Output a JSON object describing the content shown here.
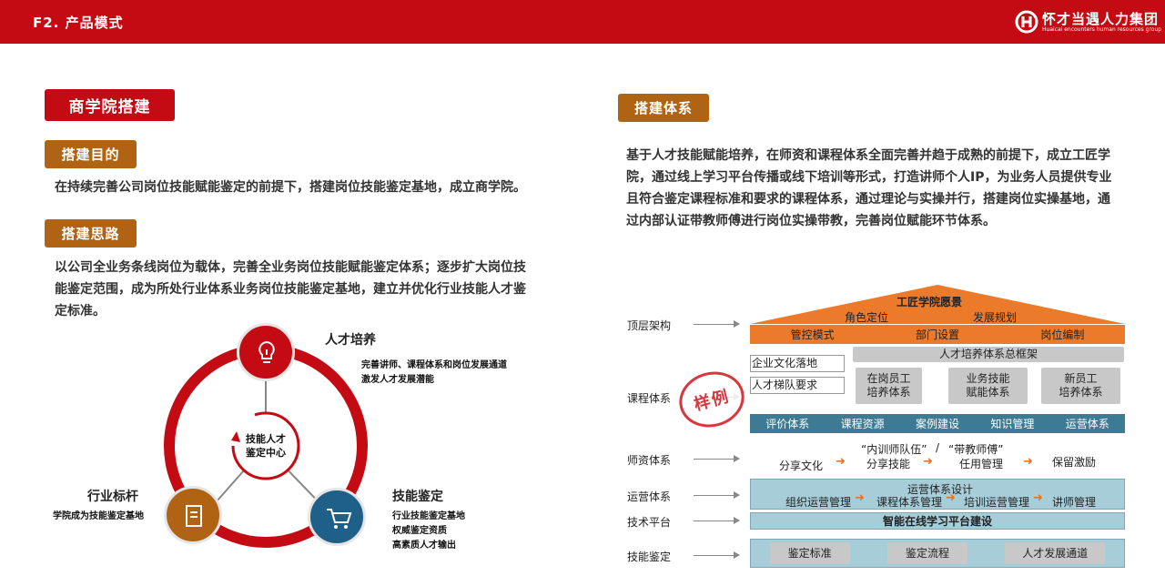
{
  "header": {
    "title": "F2. 产品模式",
    "logo_text": "怀才当遇人力集团",
    "logo_sub": "Huaicai encounters human resources group"
  },
  "left": {
    "main_tag": "商学院搭建",
    "purpose_tag": "搭建目的",
    "purpose_text": "在持续完善公司岗位技能赋能鉴定的前提下，搭建岗位技能鉴定基地，成立商学院。",
    "idea_tag": "搭建思路",
    "idea_text": "以公司全业务条线岗位为载体，完善全业务岗位技能赋能鉴定体系；逐步扩大岗位技能鉴定范围，成为所处行业体系业务岗位技能鉴定基地，建立并优化行业技能人才鉴定标准。",
    "cycle": {
      "center": "技能人才\n鉴定中心",
      "top_title": "人才培养",
      "top_desc": "完善讲师、课程体系和岗位发展通道\n激发人才发展潜能",
      "left_title": "行业标杆",
      "left_desc": "学院成为技能鉴定基地",
      "right_title": "技能鉴定",
      "right_desc": "行业技能鉴定基地\n权威鉴定资质\n高素质人才输出"
    }
  },
  "right": {
    "tag": "搭建体系",
    "text": "基于人才技能赋能培养，在师资和课程体系全面完善并趋于成熟的前提下，成立工匠学院，通过线上学习平台传播或线下培训等形式，打造讲师个人IP，为业务人员提供专业且符合鉴定课程标准和要求的课程体系，通过理论与实操并行，搭建岗位实操基地，通过内部认证带教师傅进行岗位实操带教，完善岗位赋能环节体系。",
    "diagram": {
      "row_labels": [
        "顶层架构",
        "课程体系",
        "师资体系",
        "运营体系",
        "技术平台",
        "技能鉴定"
      ],
      "roof_title": "工匠学院愿景",
      "roof_items": [
        "角色定位",
        "发展规划"
      ],
      "top_bar": [
        "管控模式",
        "部门设置",
        "岗位编制"
      ],
      "course_left": [
        "企业文化落地",
        "人才梯队要求"
      ],
      "course_header": "人才培养体系总框架",
      "course_boxes": [
        "在岗员工\n培养体系",
        "业务技能\n赋能体系",
        "新员工\n培养体系"
      ],
      "course_bottom": [
        "评价体系",
        "课程资源",
        "案例建设",
        "知识管理",
        "运营体系"
      ],
      "stamp": "样例",
      "teacher_top": [
        "“内训师队伍”",
        "/",
        "“带教师傅”"
      ],
      "teacher_flow": [
        "分享文化",
        "分享技能",
        "任用管理",
        "保留激励"
      ],
      "ops_title": "运营体系设计",
      "ops_flow": [
        "组织运营管理",
        "课程体系管理",
        "培训运营管理",
        "讲师管理"
      ],
      "tech": "智能在线学习平台建设",
      "skill": [
        "鉴定标准",
        "鉴定流程",
        "人才发展通道"
      ]
    }
  },
  "colors": {
    "brand_red": "#c40b13",
    "gold": "#b06312",
    "orange": "#ec7a2b",
    "teal": "#3d7a94",
    "light_blue": "#a7cdd9",
    "navy": "#1f6089"
  }
}
